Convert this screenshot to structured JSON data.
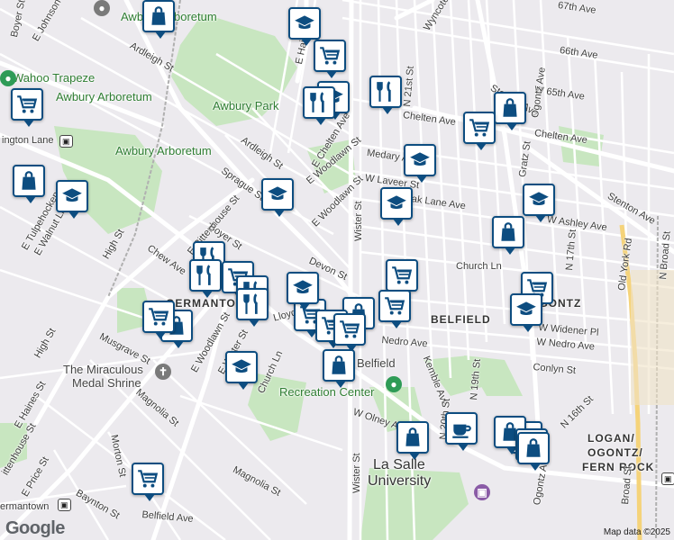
{
  "map": {
    "labels": {
      "awbury_park": "Awbury Park",
      "awbury_arboretum_1": "Awbury Arboretum",
      "awbury_arboretum_2": "Awbury Arboretum",
      "awbury_top": "Awbury Arboretum",
      "wahoo": "Wahoo Trapeze",
      "washington_lane": "ington Lane",
      "germantown": "GERMANTOWN",
      "belfield": "BELFIELD",
      "ogontz": "OGONTZ",
      "logan": "LOGAN/",
      "logan2": "OGONTZ/",
      "fern_rock": "FERN ROCK",
      "miraculous": "The Miraculous",
      "medal": "Medal Shrine",
      "recreation": "Recreation Center",
      "belfield_rec": "Belfield",
      "lasalle": "La Salle",
      "university": "University",
      "germantown_station": "ermantown"
    },
    "streets": {
      "e_johnson": "E Johnson St",
      "boyer_top": "Boyer St",
      "ardleigh_1": "Ardleigh St",
      "ardleigh_2": "Ardleigh St",
      "e_haines_top": "E Haines St",
      "wyncote": "Wyncote Ave",
      "w67": "67th Ave",
      "w66": "66th Ave",
      "w65": "W 65th Ave",
      "chelten": "Chelten Ave",
      "chelten2": "Chelten Ave",
      "e_chelten": "E Chelten Ave",
      "medary": "Medary Ave",
      "w_laveer": "W Laveer St",
      "w_olney_top": "W Oak Lane Ave",
      "n21": "N 21st St",
      "stenton1": "Stenton Ave",
      "stenton2": "Stenton Ave",
      "gratz": "Gratz St",
      "w_ashley": "W Ashley Ave",
      "sprague": "Sprague St",
      "e_woodlawn": "E Woodlawn St",
      "e_woodlawn2": "E Woodlawn St",
      "e_rittenhouse": "E Rittenhouse St",
      "boyer2": "Boyer St",
      "wister": "Wister St",
      "wister2": "Wister St",
      "devon": "Devon St",
      "church_ln": "Church Ln",
      "church_ln2": "Church Ln",
      "n17": "N 17th St",
      "old_york": "Old York Rd",
      "n_broad": "N Broad St",
      "e_tulpehocken": "E Tulpehocken St",
      "e_walnut": "E Walnut Ln",
      "high1": "High St",
      "high2": "High St",
      "chew": "Chew Ave",
      "musgrave": "Musgrave St",
      "e_haines2": "E Haines St",
      "lloyd": "Lloyd St",
      "e_woodlawn3": "E Woodlawn St",
      "e_wister": "E Wister St",
      "w_nedro": "W Nedro Ave",
      "nedro": "Nedro Ave",
      "w_widener": "W Widener Pl",
      "conlyn": "Conlyn St",
      "kemble": "Kemble Ave",
      "n20": "N 20th St",
      "n19": "N 19th St",
      "w_olney": "W Olney Ave",
      "magnolia1": "Magnolia St",
      "magnolia2": "Magnolia St",
      "morton": "Morton St",
      "e_price": "E Price St",
      "rittenhouse": "ittenhouse St",
      "baynton": "Baynton St",
      "belfield_ave": "Belfield Ave",
      "ogontz_ave": "Ogontz Ave",
      "ogontz_ave2": "Ogontz Ave",
      "n16": "N 16th St",
      "broad": "Broad St",
      "n_broad2": "N Broad"
    },
    "footer": {
      "google": "Google",
      "attribution": "Map data ©2025"
    }
  },
  "markers": [
    {
      "type": "shopping-bag"
    },
    {
      "type": "school"
    },
    {
      "type": "grocery-cart"
    },
    {
      "type": "school"
    },
    {
      "type": "restaurant"
    },
    {
      "type": "restaurant"
    },
    {
      "type": "grocery-cart"
    },
    {
      "type": "shopping-bag"
    },
    {
      "type": "grocery-cart"
    },
    {
      "type": "school"
    },
    {
      "type": "shopping-bag"
    },
    {
      "type": "school"
    },
    {
      "type": "school"
    },
    {
      "type": "school"
    },
    {
      "type": "shopping-bag"
    },
    {
      "type": "restaurant"
    },
    {
      "type": "restaurant"
    },
    {
      "type": "grocery-cart"
    },
    {
      "type": "grocery-cart"
    },
    {
      "type": "school"
    },
    {
      "type": "restaurant"
    },
    {
      "type": "restaurant"
    },
    {
      "type": "grocery-cart"
    },
    {
      "type": "shopping-bag"
    },
    {
      "type": "grocery-cart"
    },
    {
      "type": "grocery-cart"
    },
    {
      "type": "school"
    },
    {
      "type": "school"
    },
    {
      "type": "shopping-bag"
    },
    {
      "type": "grocery-cart"
    },
    {
      "type": "grocery-cart"
    },
    {
      "type": "grocery-cart"
    },
    {
      "type": "school"
    },
    {
      "type": "shopping-bag"
    },
    {
      "type": "school"
    },
    {
      "type": "shopping-bag"
    },
    {
      "type": "cafe"
    },
    {
      "type": "shopping-bag"
    },
    {
      "type": "school"
    },
    {
      "type": "shopping-bag"
    },
    {
      "type": "grocery-cart"
    }
  ],
  "colors": {
    "marker_border": "#0d4d80",
    "park": "#c8e6c0",
    "road_major": "#ffffff",
    "road_minor": "#f7f6f8"
  }
}
